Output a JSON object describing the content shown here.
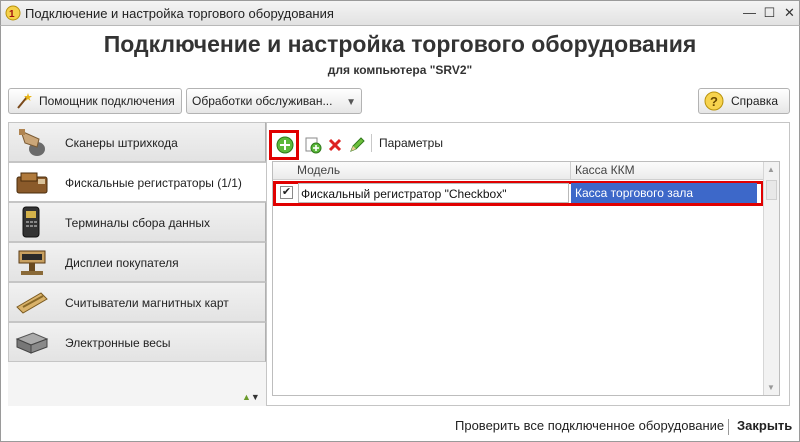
{
  "window": {
    "title": "Подключение и настройка торгового оборудования"
  },
  "header": {
    "title": "Подключение и настройка торгового оборудования",
    "subtitle": "для компьютера \"SRV2\""
  },
  "toolbar": {
    "wizard_label": "Помощник подключения",
    "service_label": "Обработки обслуживан...",
    "help_label": "Справка"
  },
  "sidebar": {
    "items": [
      {
        "label": "Сканеры штрихкода",
        "icon": "barcode-scanner-icon"
      },
      {
        "label": "Фискальные регистраторы (1/1)",
        "icon": "fiscal-register-icon",
        "active": true
      },
      {
        "label": "Терминалы сбора данных",
        "icon": "data-terminal-icon"
      },
      {
        "label": "Дисплеи покупателя",
        "icon": "customer-display-icon"
      },
      {
        "label": "Считыватели магнитных карт",
        "icon": "card-reader-icon"
      },
      {
        "label": "Электронные весы",
        "icon": "scales-icon"
      }
    ]
  },
  "main": {
    "params_label": "Параметры",
    "columns": [
      "Модель",
      "Касса ККМ"
    ],
    "rows": [
      {
        "checked": true,
        "model": "Фискальный регистратор \"Checkbox\"",
        "kassa": "Касса торгового зала"
      }
    ]
  },
  "footer": {
    "check_all_label": "Проверить все подключенное оборудование",
    "close_label": "Закрыть"
  },
  "colors": {
    "selection": "#3d68c9",
    "highlight": "#e00000"
  }
}
